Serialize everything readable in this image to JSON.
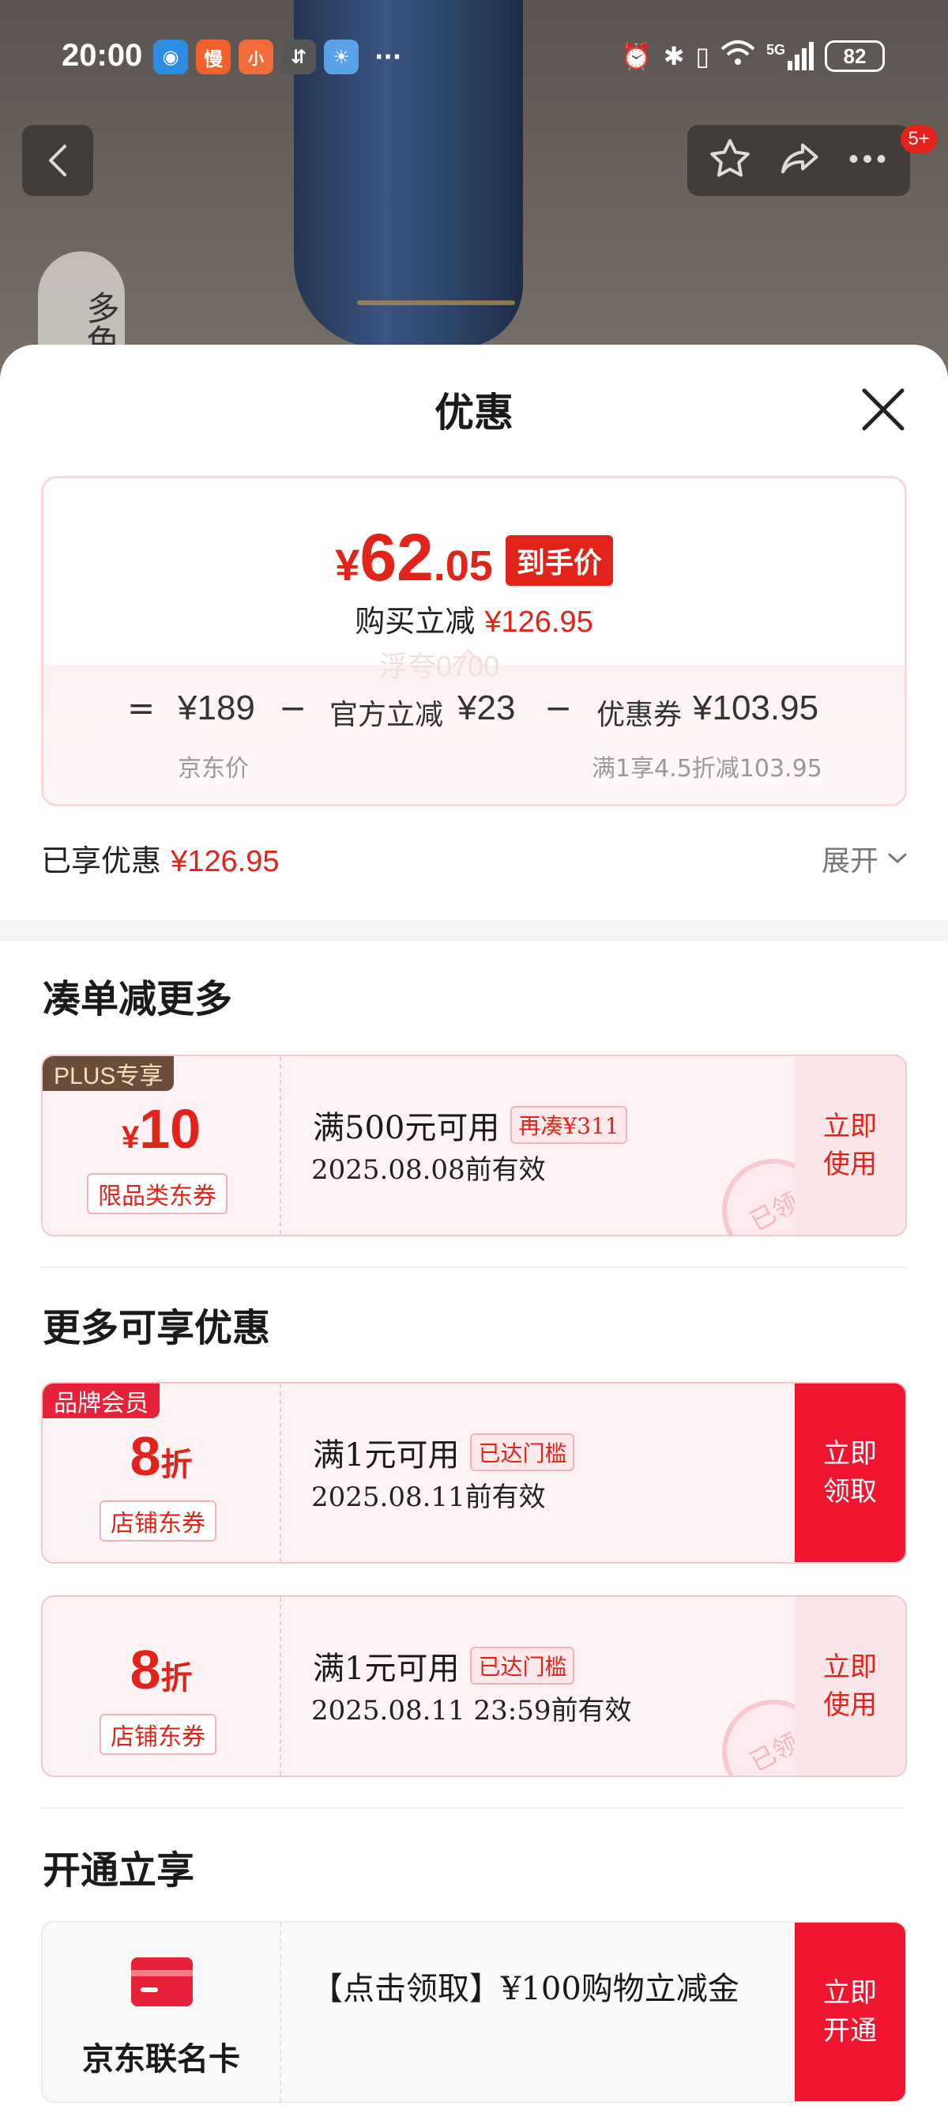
{
  "status_bar": {
    "time": "20:00",
    "apps": [
      {
        "icon": "mobile-app-icon",
        "glyph": "◉",
        "color": "#ffffff"
      },
      {
        "icon": "man-app-icon",
        "glyph": "慢",
        "color": "#f0612b"
      },
      {
        "icon": "xiaohongshu-icon",
        "glyph": "小",
        "color": "#ffffff"
      },
      {
        "icon": "sync-app-icon",
        "glyph": "⇵",
        "color": "#555555"
      },
      {
        "icon": "weather-app-icon",
        "glyph": "☀",
        "color": "#5aa0e8"
      }
    ],
    "more": "···",
    "network": "5G",
    "battery": "82"
  },
  "nav": {
    "badge": "5+",
    "side_label": "多色"
  },
  "sheet": {
    "title": "优惠",
    "final_price_symbol": "¥",
    "final_price_int": "62",
    "final_price_dec": ".05",
    "final_price_tag": "到手价",
    "buy_reduce_label": "购买立减",
    "buy_reduce_amount": "¥126.95",
    "formula": {
      "eq": "=",
      "jd_price": "¥189",
      "minus1": "−",
      "official_label": "官方立减",
      "official_amount": "¥23",
      "minus2": "−",
      "coupon_label": "优惠券",
      "coupon_amount": "¥103.95",
      "jd_price_label": "京东价",
      "coupon_note": "满1享4.5折减103.95"
    },
    "enjoyed_label": "已享优惠",
    "enjoyed_amount": "¥126.95",
    "expand_label": "展开"
  },
  "watermark": "浮夸0700",
  "section_more": {
    "title": "凑单减更多",
    "coupon": {
      "tag": "PLUS专享",
      "symbol": "¥",
      "amount": "10",
      "scope": "限品类东券",
      "condition": "满500元可用",
      "condition_tag": "再凑¥311",
      "expiry": "2025.08.08前有效",
      "action": "立即\n使用",
      "stamp": "已领"
    }
  },
  "section_enjoy": {
    "title": "更多可享优惠",
    "coupons": [
      {
        "tag": "品牌会员",
        "amount": "8",
        "unit": "折",
        "scope": "店铺东券",
        "condition": "满1元可用",
        "condition_tag": "已达门槛",
        "expiry": "2025.08.11前有效",
        "action": "立即\n领取"
      },
      {
        "amount": "8",
        "unit": "折",
        "scope": "店铺东券",
        "condition": "满1元可用",
        "condition_tag": "已达门槛",
        "expiry": "2025.08.11 23:59前有效",
        "action": "立即\n使用",
        "stamp": "已领"
      }
    ]
  },
  "section_open": {
    "title": "开通立享",
    "card_name": "京东联名卡",
    "card_desc": "【点击领取】¥100购物立减金",
    "action": "立即\n开通"
  },
  "colors": {
    "accent": "#e2231a",
    "button_red": "#f0152f",
    "plus_tag": "#6b4d3c"
  }
}
